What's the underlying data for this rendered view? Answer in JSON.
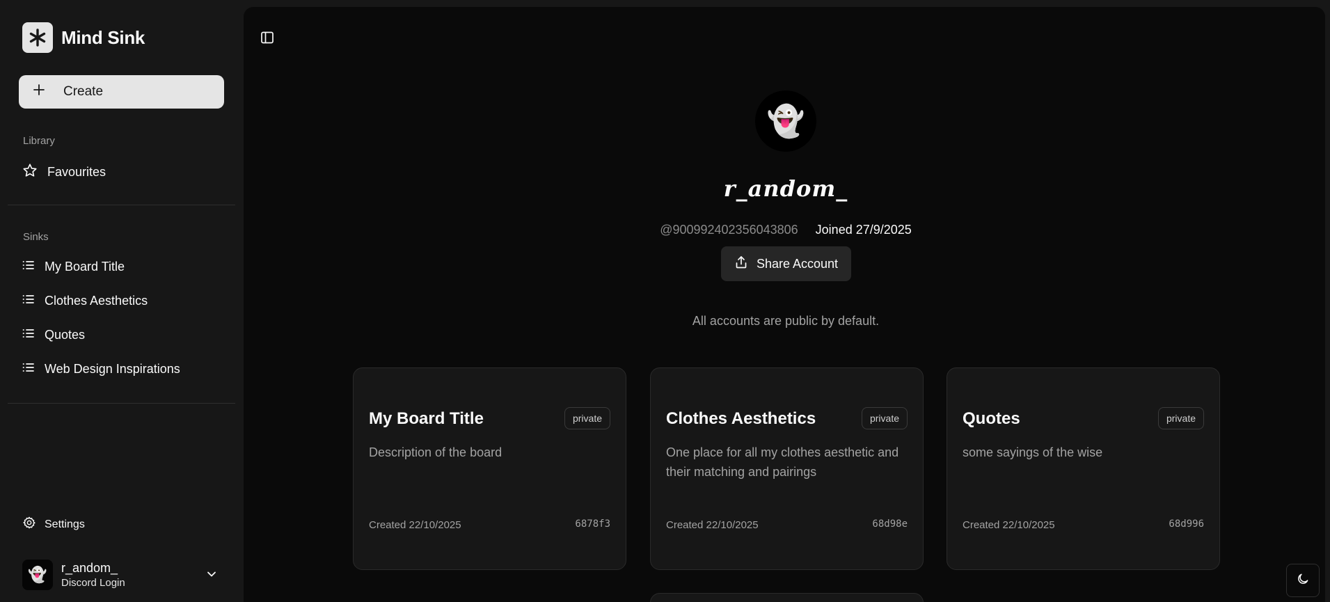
{
  "app": {
    "name": "Mind Sink"
  },
  "sidebar": {
    "create_label": "Create",
    "library_label": "Library",
    "library_items": [
      {
        "label": "Favourites",
        "icon": "star-icon"
      }
    ],
    "sinks_label": "Sinks",
    "sinks": [
      {
        "label": "My Board Title",
        "icon": "list-icon"
      },
      {
        "label": "Clothes Aesthetics",
        "icon": "list-icon"
      },
      {
        "label": "Quotes",
        "icon": "list-icon"
      },
      {
        "label": "Web Design Inspirations",
        "icon": "list-icon"
      }
    ],
    "settings_label": "Settings",
    "user": {
      "name": "r_andom_",
      "login": "Discord Login",
      "avatar": "👻"
    }
  },
  "profile": {
    "avatar": "👻",
    "name": "r_andom_",
    "handle": "@900992402356043806",
    "joined": "Joined 27/9/2025",
    "share_label": "Share Account",
    "public_note": "All accounts are public by default."
  },
  "boards": [
    {
      "title": "My Board Title",
      "badge": "private",
      "description": "Description of the board",
      "created": "Created 22/10/2025",
      "id": "6878f3"
    },
    {
      "title": "Clothes Aesthetics",
      "badge": "private",
      "description": "One place for all my clothes aesthetic and their matching and pairings",
      "created": "Created 22/10/2025",
      "id": "68d98e"
    },
    {
      "title": "Quotes",
      "badge": "private",
      "description": "some sayings of the wise",
      "created": "Created 22/10/2025",
      "id": "68d996"
    }
  ],
  "colors": {
    "sidebar_bg": "#171717",
    "main_bg": "#0a0a0a",
    "card_bg": "#171717",
    "accent": "#e5e5e5"
  }
}
